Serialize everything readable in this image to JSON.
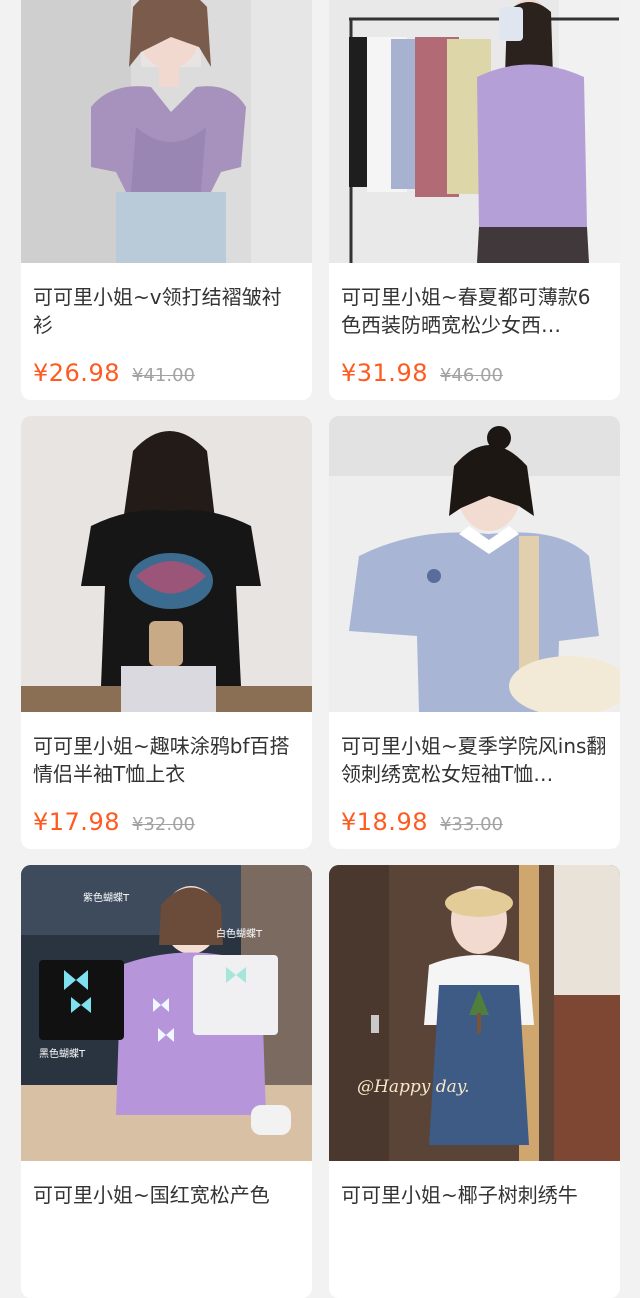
{
  "products": [
    {
      "title": "可可里小姐~v领打结褶皱衬衫",
      "price": "¥26.98",
      "original_price": "¥41.00",
      "image_label": "product-photo-purple-blouse"
    },
    {
      "title": "可可里小姐~春夏都可薄款6色西装防晒宽松少女西…",
      "price": "¥31.98",
      "original_price": "¥46.00",
      "image_label": "product-photo-purple-blazer"
    },
    {
      "title": "可可里小姐~趣味涂鸦bf百搭情侣半袖T恤上衣",
      "price": "¥17.98",
      "original_price": "¥32.00",
      "image_label": "product-photo-black-tshirt"
    },
    {
      "title": "可可里小姐~夏季学院风ins翻领刺绣宽松女短袖T恤…",
      "price": "¥18.98",
      "original_price": "¥33.00",
      "image_label": "product-photo-blue-polo"
    },
    {
      "title": "可可里小姐~国红宽松产色",
      "price": "",
      "original_price": "",
      "image_label": "product-photo-purple-butterfly-tee",
      "overlay": {
        "black_tag": "黑色蝴蝶T",
        "purple_tag": "紫色蝴蝶T",
        "white_tag": "白色蝴蝶T"
      }
    },
    {
      "title": "可可里小姐~椰子树刺绣牛",
      "price": "",
      "original_price": "",
      "image_label": "product-photo-denim-overalls",
      "overlay": {
        "script": "@Happy day."
      }
    }
  ],
  "colors": {
    "page_bg": "#f2f2f2",
    "card_bg": "#ffffff",
    "price": "#ff5a1f",
    "original_price": "#a3a3a3",
    "title": "#333333"
  }
}
